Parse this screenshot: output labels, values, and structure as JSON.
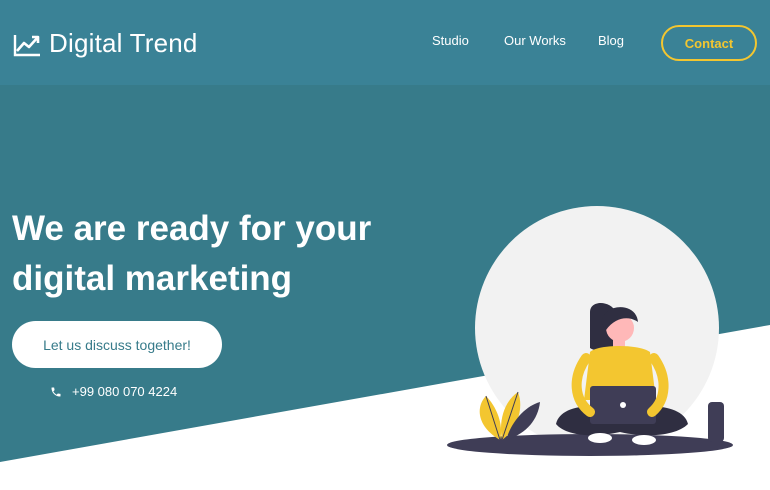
{
  "brand": {
    "name": "Digital Trend",
    "logo_icon": "trend-chart-icon"
  },
  "nav": {
    "links": [
      "Studio",
      "Our Works",
      "Blog"
    ],
    "contact_label": "Contact"
  },
  "hero": {
    "title_line1": "We are ready for your",
    "title_line2": "digital marketing",
    "cta_label": "Let us discuss together!",
    "phone_icon": "phone-icon",
    "phone": "+99 080 070 4224",
    "illustration": "woman-with-laptop-illustration"
  },
  "colors": {
    "header_bg": "#3a8296",
    "hero_bg": "#377b8a",
    "accent_yellow": "#f3c630",
    "white": "#ffffff",
    "circle": "#f2f2f2",
    "dark": "#3f3d56"
  }
}
